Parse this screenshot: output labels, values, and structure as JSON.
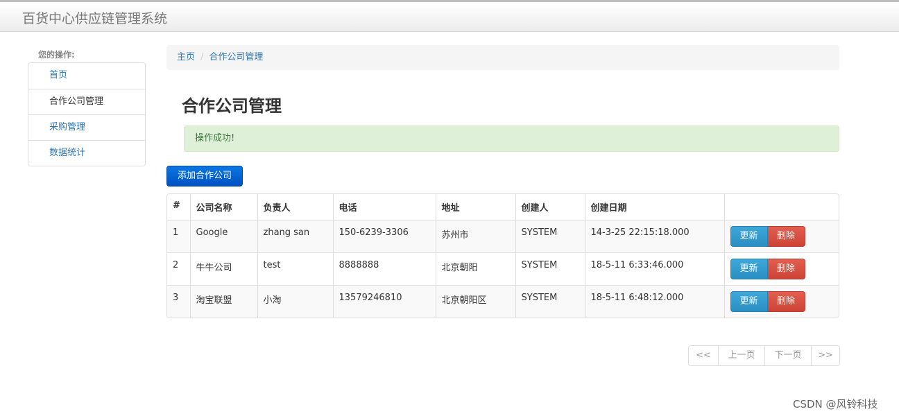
{
  "app": {
    "title": "百货中心供应链管理系统"
  },
  "sidebar": {
    "heading": "您的操作:",
    "items": [
      {
        "label": "首页"
      },
      {
        "label": "合作公司管理"
      },
      {
        "label": "采购管理"
      },
      {
        "label": "数据统计"
      }
    ]
  },
  "breadcrumb": {
    "home": "主页",
    "separator": "/",
    "current": "合作公司管理"
  },
  "page": {
    "title": "合作公司管理"
  },
  "alert": {
    "message": "操作成功!"
  },
  "toolbar": {
    "add_label": "添加合作公司"
  },
  "table": {
    "headers": [
      "#",
      "公司名称",
      "负责人",
      "电话",
      "地址",
      "创建人",
      "创建日期",
      ""
    ],
    "rows": [
      {
        "no": "1",
        "name": "Google",
        "manager": "zhang san",
        "phone": "150-6239-3306",
        "address": "苏州市",
        "creator": "SYSTEM",
        "created": "14-3-25 22:15:18.000"
      },
      {
        "no": "2",
        "name": "牛牛公司",
        "manager": "test",
        "phone": "8888888",
        "address": "北京朝阳",
        "creator": "SYSTEM",
        "created": "18-5-11 6:33:46.000"
      },
      {
        "no": "3",
        "name": "淘宝联盟",
        "manager": "小淘",
        "phone": "13579246810",
        "address": "北京朝阳区",
        "creator": "SYSTEM",
        "created": "18-5-11 6:48:12.000"
      }
    ],
    "update_label": "更新",
    "delete_label": "删除"
  },
  "pagination": {
    "first": "<<",
    "prev": "上一页",
    "next": "下一页",
    "last": ">>"
  },
  "watermark": {
    "text": "CSDN @风铃科技"
  },
  "colors": {
    "link": "#2a75b3",
    "primary": "#0051c2",
    "info": "#2a8fc4",
    "danger": "#cd4436",
    "success_bg": "#dff0d8"
  }
}
